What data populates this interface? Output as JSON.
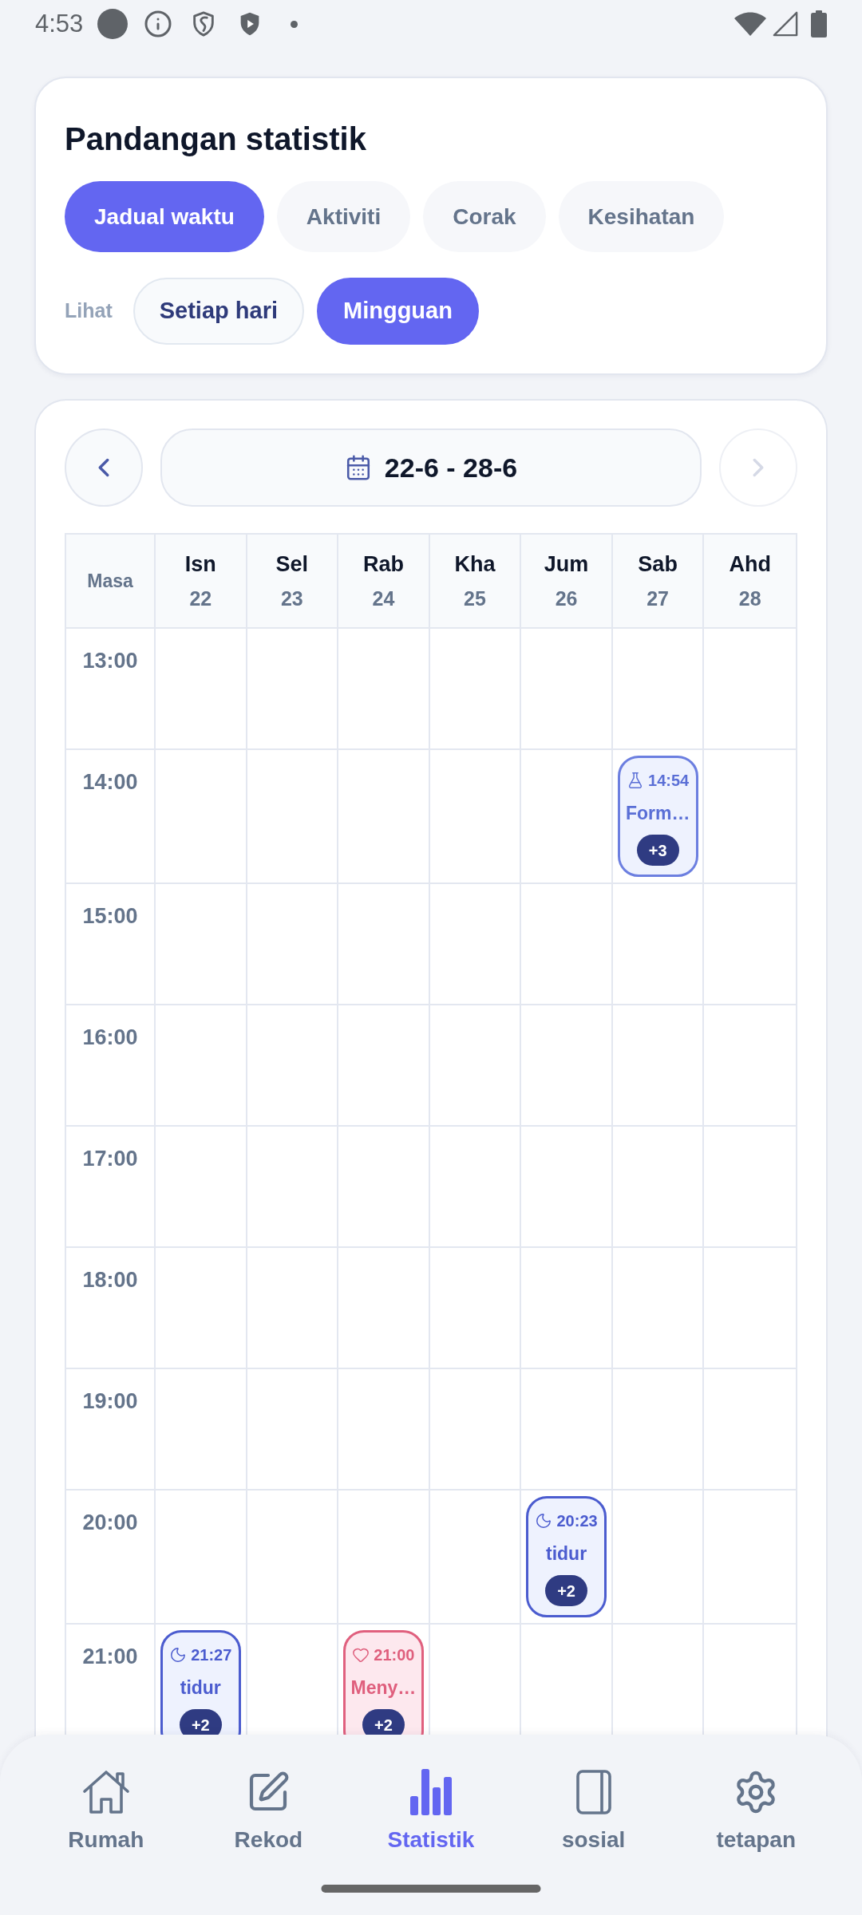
{
  "status_bar": {
    "time": "4:53"
  },
  "stats_card": {
    "title": "Pandangan statistik",
    "tabs": [
      {
        "label": "Jadual waktu",
        "selected": true
      },
      {
        "label": "Aktiviti",
        "selected": false
      },
      {
        "label": "Corak",
        "selected": false
      },
      {
        "label": "Kesihatan",
        "selected": false
      }
    ],
    "view": {
      "label": "Lihat",
      "options": [
        {
          "label": "Setiap hari",
          "selected": false
        },
        {
          "label": "Mingguan",
          "selected": true
        }
      ]
    }
  },
  "date_nav": {
    "range": "22-6 - 28-6",
    "prev": {
      "disabled": false
    },
    "next": {
      "disabled": true
    }
  },
  "schedule": {
    "time_header": "Masa",
    "days": [
      {
        "name": "Isn",
        "date": "22"
      },
      {
        "name": "Sel",
        "date": "23"
      },
      {
        "name": "Rab",
        "date": "24"
      },
      {
        "name": "Kha",
        "date": "25"
      },
      {
        "name": "Jum",
        "date": "26"
      },
      {
        "name": "Sab",
        "date": "27"
      },
      {
        "name": "Ahd",
        "date": "28"
      }
    ],
    "rows": [
      {
        "time": "13:00",
        "cells": [
          null,
          null,
          null,
          null,
          null,
          null,
          null
        ]
      },
      {
        "time": "14:00",
        "cells": [
          null,
          null,
          null,
          null,
          null,
          {
            "kind": "lab",
            "time": "14:54",
            "title": "Form…",
            "more": "+3"
          },
          null
        ]
      },
      {
        "time": "15:00",
        "cells": [
          null,
          null,
          null,
          null,
          null,
          null,
          null
        ]
      },
      {
        "time": "16:00",
        "cells": [
          null,
          null,
          null,
          null,
          null,
          null,
          null
        ]
      },
      {
        "time": "17:00",
        "cells": [
          null,
          null,
          null,
          null,
          null,
          null,
          null
        ]
      },
      {
        "time": "18:00",
        "cells": [
          null,
          null,
          null,
          null,
          null,
          null,
          null
        ]
      },
      {
        "time": "19:00",
        "cells": [
          null,
          null,
          null,
          null,
          null,
          null,
          null
        ]
      },
      {
        "time": "20:00",
        "cells": [
          null,
          null,
          null,
          null,
          {
            "kind": "sleep",
            "time": "20:23",
            "title": "tidur",
            "more": "+2"
          },
          null,
          null
        ]
      },
      {
        "time": "21:00",
        "cells": [
          {
            "kind": "sleep",
            "time": "21:27",
            "title": "tidur",
            "more": "+2"
          },
          null,
          {
            "kind": "health",
            "time": "21:00",
            "title": "Meny…",
            "more": "+2"
          },
          null,
          null,
          null,
          null
        ]
      }
    ]
  },
  "bottom_nav": [
    {
      "label": "Rumah",
      "selected": false
    },
    {
      "label": "Rekod",
      "selected": false
    },
    {
      "label": "Statistik",
      "selected": true
    },
    {
      "label": "sosial",
      "selected": false
    },
    {
      "label": "tetapan",
      "selected": false
    }
  ]
}
